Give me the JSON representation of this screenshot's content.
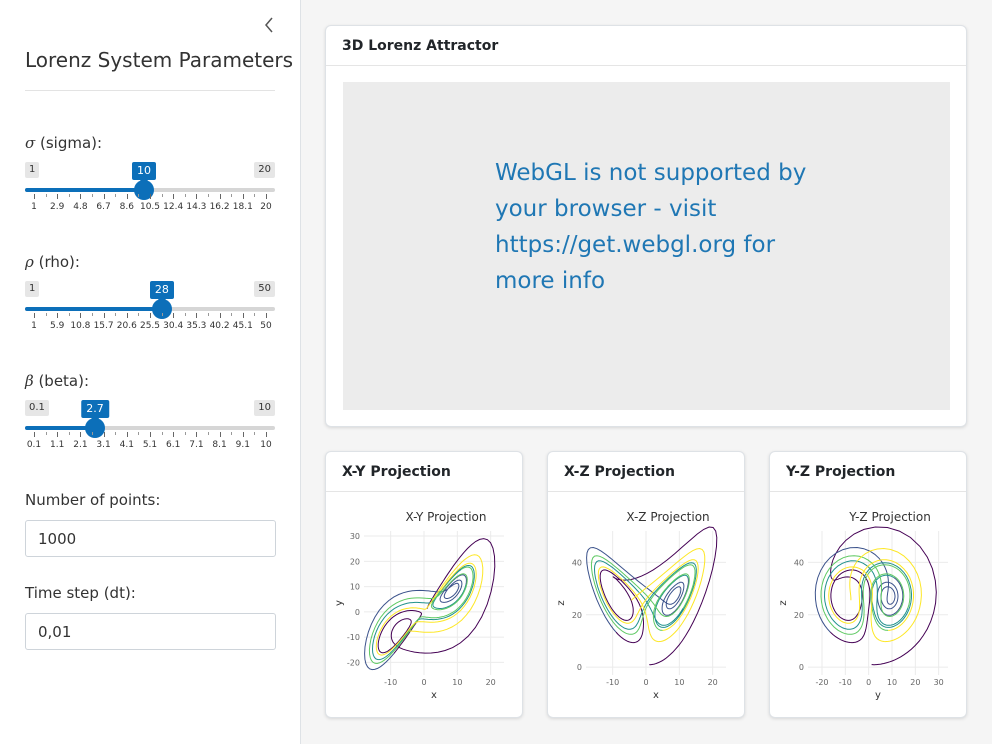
{
  "sidebar": {
    "title": "Lorenz System Parameters",
    "sliders": [
      {
        "symbol": "σ",
        "label": " (sigma):",
        "min_label": "1",
        "max_label": "20",
        "value": "10",
        "fraction": 0.474,
        "ticks": [
          "1",
          "2.9",
          "4.8",
          "6.7",
          "8.6",
          "10.5",
          "12.4",
          "14.3",
          "16.2",
          "18.1",
          "20"
        ]
      },
      {
        "symbol": "ρ",
        "label": " (rho):",
        "min_label": "1",
        "max_label": "50",
        "value": "28",
        "fraction": 0.551,
        "ticks": [
          "1",
          "5.9",
          "10.8",
          "15.7",
          "20.6",
          "25.5",
          "30.4",
          "35.3",
          "40.2",
          "45.1",
          "50"
        ]
      },
      {
        "symbol": "β",
        "label": " (beta):",
        "min_label": "0.1",
        "max_label": "10",
        "value": "2.7",
        "fraction": 0.263,
        "ticks": [
          "0.1",
          "1.1",
          "2.1",
          "3.1",
          "4.1",
          "5.1",
          "6.1",
          "7.1",
          "8.1",
          "9.1",
          "10"
        ]
      }
    ],
    "points_label": "Number of points:",
    "points_value": "1000",
    "dt_label": "Time step (dt):",
    "dt_value": "0,01"
  },
  "main": {
    "attractor_title": "3D Lorenz Attractor",
    "webgl_message": "WebGL is not supported by your browser - visit https://get.webgl.org for more info",
    "projections": [
      {
        "card_title": "X-Y Projection",
        "plot_title": "X-Y Projection",
        "xlabel": "x",
        "ylabel": "y",
        "xticks": [
          "-10",
          "0",
          "10",
          "20"
        ],
        "yticks": [
          "30",
          "20",
          "10",
          "0",
          "-10",
          "-20"
        ]
      },
      {
        "card_title": "X-Z Projection",
        "plot_title": "X-Z Projection",
        "xlabel": "x",
        "ylabel": "z",
        "xticks": [
          "-10",
          "0",
          "10",
          "20"
        ],
        "yticks": [
          "40",
          "20",
          "0"
        ]
      },
      {
        "card_title": "Y-Z Projection",
        "plot_title": "Y-Z Projection",
        "xlabel": "y",
        "ylabel": "z",
        "xticks": [
          "-20",
          "-10",
          "0",
          "10",
          "20",
          "30"
        ],
        "yticks": [
          "40",
          "20",
          "0"
        ]
      }
    ]
  },
  "colors": {
    "accent": "#0c6fb9",
    "webgl_text": "#1f77b4",
    "viridis": [
      "#440154",
      "#3b528b",
      "#21918c",
      "#5ec962",
      "#fde725"
    ]
  }
}
